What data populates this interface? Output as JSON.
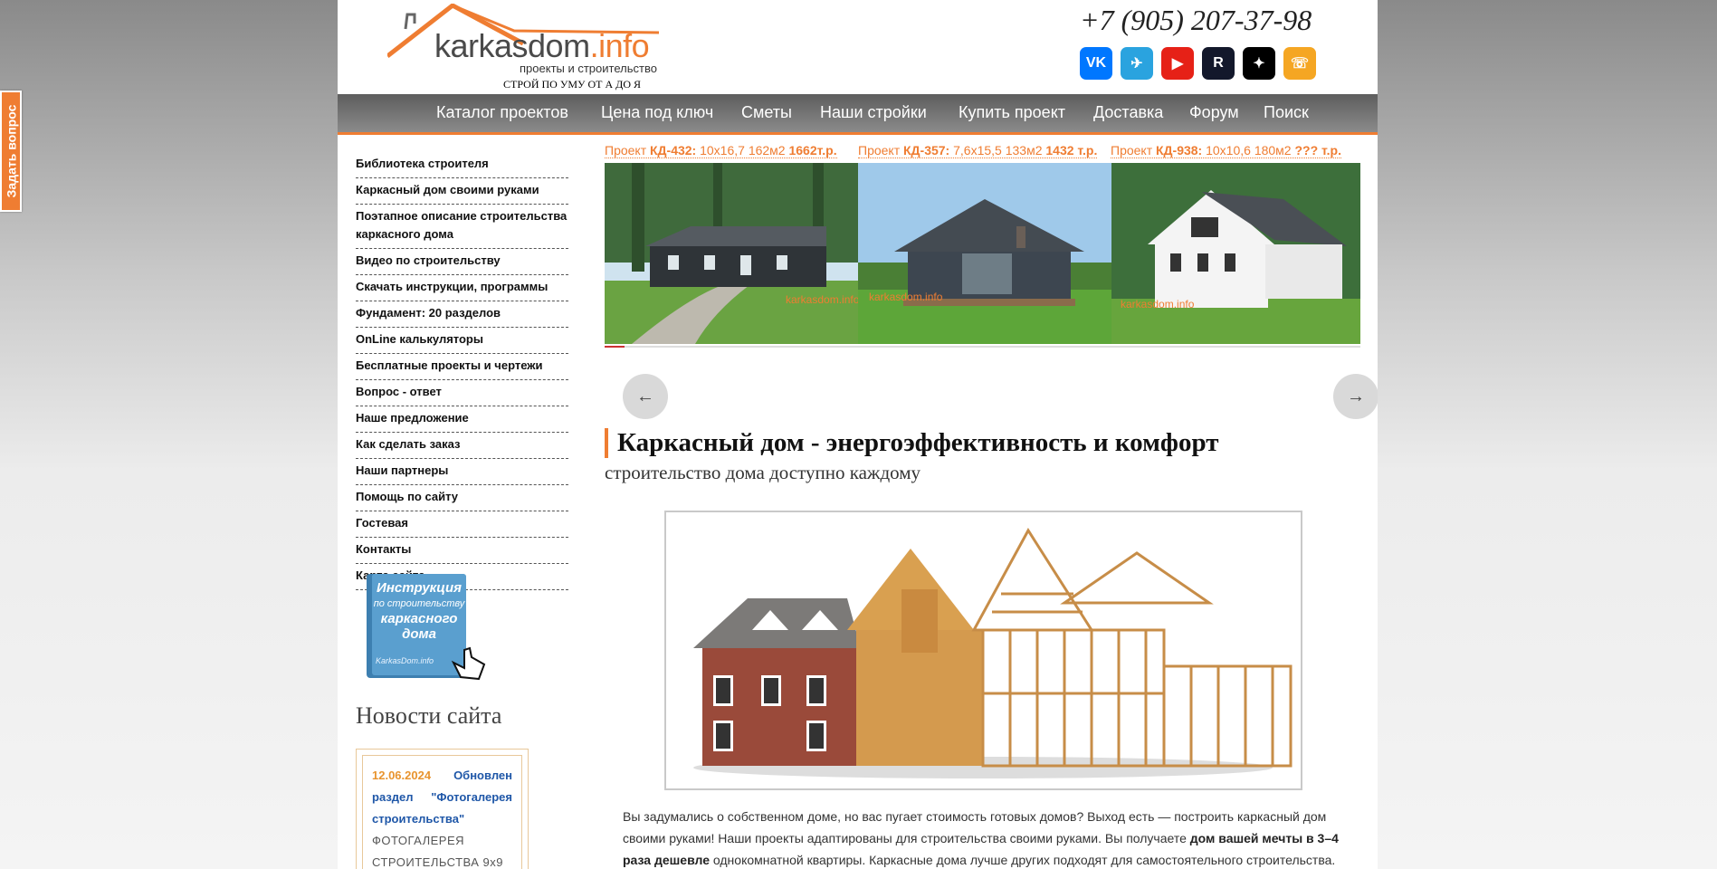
{
  "side_tab": {
    "label": "Задать вопрос"
  },
  "header": {
    "logo_main": "karkasdom",
    "logo_accent": ".info",
    "logo_tagline": "проекты и строительство",
    "logo_slogan": "СТРОЙ ПО УМУ ОТ А ДО Я",
    "phone": "+7 (905) 207-37-98",
    "social": [
      {
        "icon": "vk-icon",
        "glyph": "VK"
      },
      {
        "icon": "telegram-icon",
        "glyph": "✈"
      },
      {
        "icon": "youtube-icon",
        "glyph": "▶"
      },
      {
        "icon": "rutube-icon",
        "glyph": "R"
      },
      {
        "icon": "dzen-icon",
        "glyph": "✦"
      },
      {
        "icon": "phone-icon",
        "glyph": "☏"
      }
    ]
  },
  "nav": {
    "items": [
      "Каталог проектов",
      "Цена под ключ",
      "Сметы",
      "Наши стройки",
      "Купить проект",
      "Доставка",
      "Форум",
      "Поиск"
    ]
  },
  "sidebar": {
    "items": [
      "Библиотека строителя",
      "Каркасный дом своими руками",
      "Поэтапное описание строительства каркасного дома",
      "Видео по строительству",
      "Скачать инструкции, программы",
      "Фундамент: 20 разделов",
      "OnLine калькуляторы",
      "Бесплатные проекты и чертежи",
      "Вопрос - ответ",
      "Наше предложение",
      "Как сделать заказ",
      "Наши партнеры",
      "Помощь по сайту",
      "Гостевая",
      "Контакты",
      "Карта сайта"
    ],
    "book": {
      "line1": "Инструкция",
      "line2": "по строительству",
      "line3": "каркасного",
      "line4": "дома",
      "brand": "KarkasDom.info"
    },
    "news_title": "Новости сайта",
    "news": {
      "date": "12.06.2024",
      "link": "Обновлен раздел \"Фотогалерея строительства\"",
      "text": "ФОТОГАЛЕРЕЯ СТРОИТЕЛЬСТВА 9x9"
    }
  },
  "carousel": {
    "projects": [
      {
        "prefix": "Проект ",
        "code": "КД-432:",
        "desc": " 10x16,7 162м2 ",
        "price": "1662т.р."
      },
      {
        "prefix": "Проект ",
        "code": "КД-357:",
        "desc": " 7,6x15,5 133м2 ",
        "price": "1432 т.р."
      },
      {
        "prefix": "Проект ",
        "code": "КД-938:",
        "desc": " 10x10,6 180м2 ",
        "price": "??? т.р."
      }
    ],
    "prev": "←",
    "next": "→",
    "watermark": "karkasdom.info"
  },
  "main": {
    "title": "Каркасный дом - энергоэффективность и комфорт",
    "subtitle": "строительство дома доступно каждому",
    "intro_1": "Вы задумались о собственном доме, но вас пугает стоимость готовых домов? Выход есть — построить каркасный дом своими руками! Наши проекты адаптированы для строительства своими руками. Вы получаете ",
    "intro_bold": "дом вашей мечты в 3–4 раза дешевле",
    "intro_2": " однокомнатной квартиры. Каркасные дома лучше других подходят для самостоятельного строительства."
  },
  "colors": {
    "accent": "#ef7d32",
    "nav_bg": "#6e6e6e",
    "link": "#1f57a8"
  }
}
